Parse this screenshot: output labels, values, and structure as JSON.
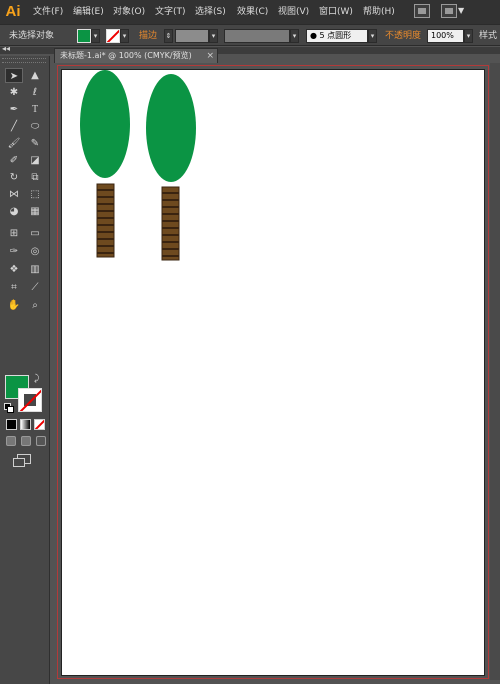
{
  "app": {
    "logo": "Ai"
  },
  "menubar": {
    "items": [
      "文件(F)",
      "编辑(E)",
      "对象(O)",
      "文字(T)",
      "选择(S)",
      "效果(C)",
      "视图(V)",
      "窗口(W)",
      "帮助(H)"
    ]
  },
  "controlbar": {
    "selection_status": "未选择对象",
    "fill_color": "#0b9444",
    "stroke_label": "描边",
    "brush_value": "5 点圆形",
    "opacity_label": "不透明度",
    "opacity_value": "100%",
    "style_label": "样式"
  },
  "document": {
    "tab_title": "未标题-1.ai* @ 100% (CMYK/预览)"
  },
  "colors": {
    "tree_leaf": "#0b9444",
    "trunk": "#6e4a1f",
    "trunk_stripe": "#3a2410",
    "artboard_border": "#b23a3a"
  },
  "tools": [
    "selection-tool",
    "direct-selection-tool",
    "magic-wand-tool",
    "lasso-tool",
    "pen-tool",
    "type-tool",
    "line-segment-tool",
    "ellipse-tool",
    "paintbrush-tool",
    "pencil-tool",
    "blob-brush-tool",
    "eraser-tool",
    "rotate-tool",
    "scale-tool",
    "width-tool",
    "free-transform-tool",
    "shape-builder-tool",
    "perspective-grid-tool",
    "mesh-tool",
    "gradient-tool",
    "eyedropper-tool",
    "blend-tool",
    "symbol-sprayer-tool",
    "column-graph-tool",
    "artboard-tool",
    "slice-tool",
    "hand-tool",
    "zoom-tool"
  ]
}
